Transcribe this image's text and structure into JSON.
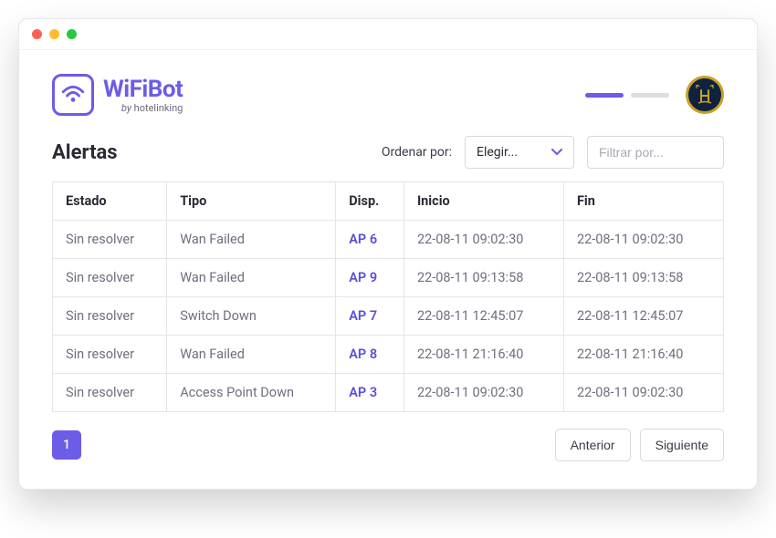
{
  "brand": {
    "title": "WiFiBot",
    "by_prefix": "by",
    "by_name": "hotelinking"
  },
  "page": {
    "title": "Alertas",
    "sort_label": "Ordenar por:",
    "select_placeholder": "Elegir...",
    "filter_placeholder": "Filtrar por..."
  },
  "table": {
    "columns": {
      "estado": "Estado",
      "tipo": "Tipo",
      "disp": "Disp.",
      "inicio": "Inicio",
      "fin": "Fin"
    },
    "rows": [
      {
        "estado": "Sin resolver",
        "tipo": "Wan Failed",
        "disp": "AP 6",
        "inicio": "22-08-11  09:02:30",
        "fin": "22-08-11  09:02:30"
      },
      {
        "estado": "Sin resolver",
        "tipo": "Wan Failed",
        "disp": "AP 9",
        "inicio": "22-08-11  09:13:58",
        "fin": "22-08-11  09:13:58"
      },
      {
        "estado": "Sin resolver",
        "tipo": "Switch Down",
        "disp": "AP 7",
        "inicio": "22-08-11  12:45:07",
        "fin": "22-08-11  12:45:07"
      },
      {
        "estado": "Sin resolver",
        "tipo": "Wan Failed",
        "disp": "AP 8",
        "inicio": "22-08-11  21:16:40",
        "fin": "22-08-11  21:16:40"
      },
      {
        "estado": "Sin resolver",
        "tipo": "Access Point Down",
        "disp": "AP 3",
        "inicio": "22-08-11  09:02:30",
        "fin": "22-08-11  09:02:30"
      }
    ]
  },
  "pagination": {
    "current": "1",
    "prev_label": "Anterior",
    "next_label": "Siguiente"
  }
}
